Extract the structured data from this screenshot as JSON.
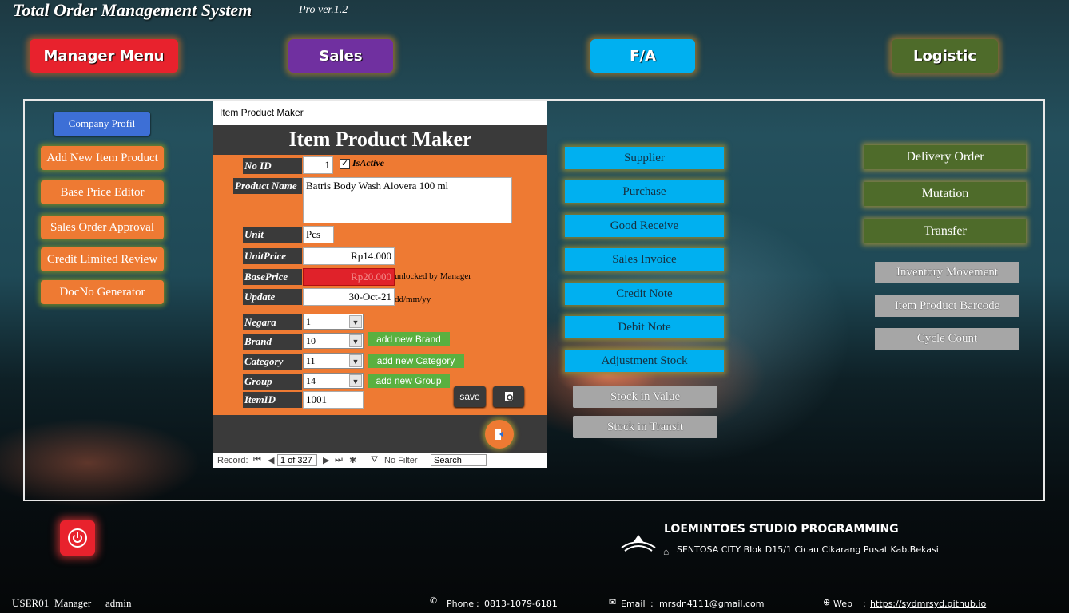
{
  "app": {
    "title": "Total Order Management System",
    "version": "Pro ver.1.2"
  },
  "top_menu": {
    "manager": "Manager Menu",
    "sales": "Sales",
    "fa": "F/A",
    "logistic": "Logistic"
  },
  "left_menu": {
    "company": "Company Profil",
    "add_item": "Add New Item Product",
    "base_price": "Base Price Editor",
    "so_approval": "Sales Order Approval",
    "credit": "Credit Limited Review",
    "docno": "DocNo Generator"
  },
  "form": {
    "window_title": "Item Product Maker",
    "header": "Item Product Maker",
    "labels": {
      "no_id": "No ID",
      "is_active": "IsActive",
      "product_name": "Product Name",
      "unit": "Unit",
      "unit_price": "UnitPrice",
      "base_price": "BasePrice",
      "update": "Update",
      "negara": "Negara",
      "brand": "Brand",
      "category": "Category",
      "group": "Group",
      "item_id": "ItemID"
    },
    "values": {
      "no_id": "1",
      "product_name": "Batris Body Wash Alovera 100 ml",
      "unit": "Pcs",
      "unit_price": "Rp14.000",
      "base_price": "Rp20.000",
      "update": "30-Oct-21",
      "negara": "1",
      "brand": "10",
      "category": "11",
      "group": "14",
      "item_id": "1001"
    },
    "notes": {
      "base_price": "unlocked by Manager",
      "update": "dd/mm/yy"
    },
    "buttons": {
      "add_brand": "add new Brand",
      "add_category": "add new Category",
      "add_group": "add new Group",
      "save": "save"
    },
    "record_nav": {
      "label": "Record:",
      "position": "1 of 327",
      "filter": "No Filter",
      "search": "Search"
    }
  },
  "center_menu": {
    "supplier": "Supplier",
    "purchase": "Purchase",
    "good_receive": "Good Receive",
    "sales_invoice": "Sales Invoice",
    "credit_note": "Credit Note",
    "debit_note": "Debit Note",
    "adjustment": "Adjustment Stock",
    "stock_value": "Stock in Value",
    "stock_transit": "Stock in Transit"
  },
  "right_menu": {
    "delivery": "Delivery Order",
    "mutation": "Mutation",
    "transfer": "Transfer",
    "inventory": "Inventory Movement",
    "barcode": "Item Product Barcode",
    "cycle": "Cycle Count"
  },
  "company": {
    "name": "LOEMINTOES STUDIO PROGRAMMING",
    "address": "SENTOSA CITY Blok D15/1 Cicau Cikarang Pusat Kab.Bekasi"
  },
  "footer": {
    "user": "USER01",
    "role": "Manager",
    "login": "admin",
    "phone_label": "Phone",
    "phone": "0813-1079-6181",
    "email_label": "Email",
    "email": "mrsdn4111@gmail.com",
    "web_label": "Web",
    "web": "https://sydmrsyd.github.io"
  }
}
